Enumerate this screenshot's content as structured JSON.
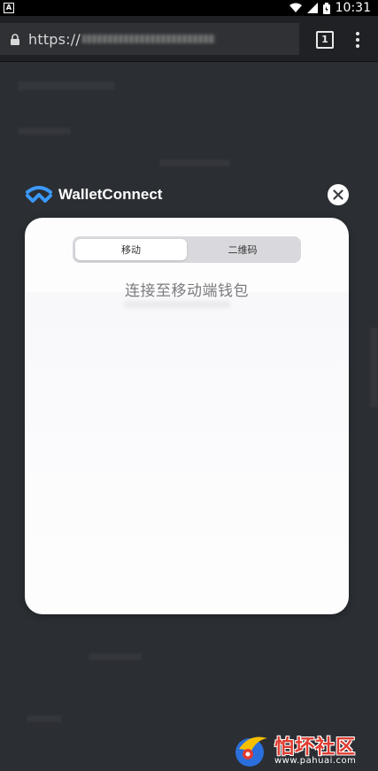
{
  "status_bar": {
    "app_badge": "A",
    "time": "10:31"
  },
  "browser": {
    "url": "https://",
    "tab_count": "1"
  },
  "wallet_connect": {
    "brand": "WalletConnect",
    "tabs": [
      {
        "label": "移动",
        "active": true
      },
      {
        "label": "二维码",
        "active": false
      }
    ],
    "title": "连接至移动端钱包"
  },
  "watermark": {
    "title": "怕坏社区",
    "url": "www.pahuai.com"
  },
  "colors": {
    "backdrop": "#2b2e33",
    "modal_bg": "#fdfdfd",
    "walletconnect_blue": "#3b99fc",
    "watermark_red": "#e03c31"
  }
}
